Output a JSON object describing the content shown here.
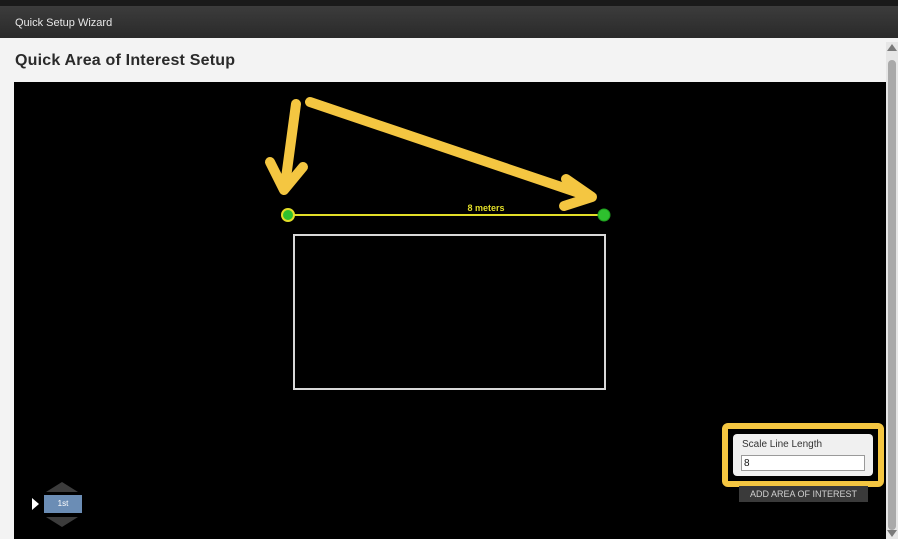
{
  "window": {
    "title": "Quick Setup Wizard"
  },
  "page": {
    "title": "Quick Area of Interest Setup"
  },
  "canvas": {
    "scale_line": {
      "label": "8 meters",
      "color": "#e2de28",
      "endpoint_color": "#2ec02e"
    },
    "annotation_color": "#f4c641"
  },
  "slider": {
    "value": "1st",
    "color": "#6b8db5"
  },
  "scale_panel": {
    "label": "Scale Line Length",
    "value": "8"
  },
  "actions": {
    "add_area_label": "ADD AREA OF INTEREST"
  }
}
